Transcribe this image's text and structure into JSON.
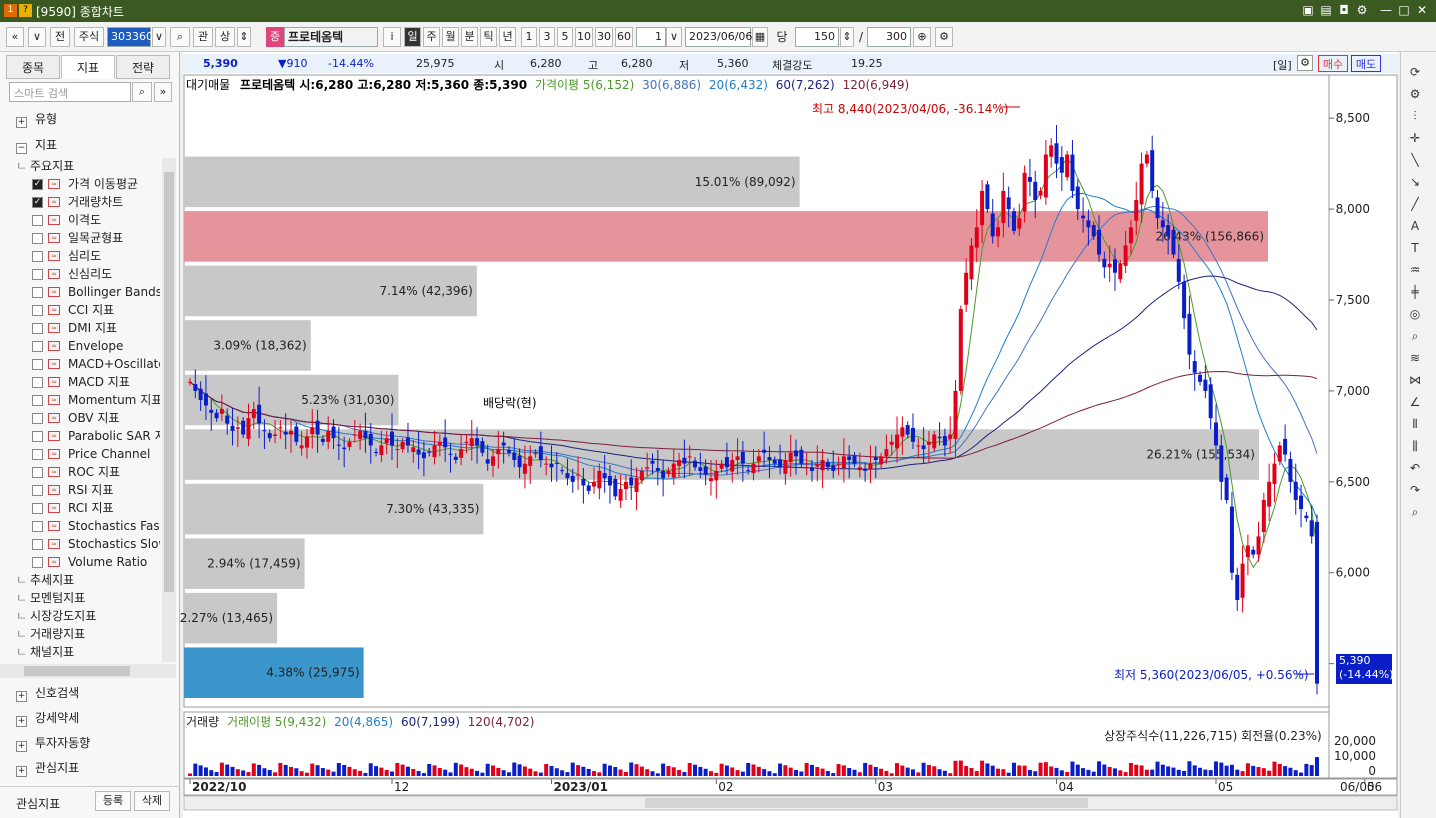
{
  "window": {
    "badge1": "1",
    "badge2": "?",
    "title": "[9590] 종합차트"
  },
  "toolbar": {
    "nav_prev": "«",
    "nav_down": "∨",
    "all": "전",
    "stock": "주식",
    "code": "303360",
    "kwan": "관",
    "sang": "상",
    "market_badge": "증",
    "name": "프로테옴텍",
    "info": "i",
    "periods": [
      "일",
      "주",
      "월",
      "분",
      "틱",
      "년"
    ],
    "intervals": [
      "1",
      "3",
      "5",
      "10",
      "30",
      "60"
    ],
    "unit_value": "1",
    "date": "2023/06/06",
    "dang": "당",
    "count": "150",
    "slash": "/",
    "total": "300"
  },
  "left": {
    "tabs": [
      "종목",
      "지표",
      "전략"
    ],
    "search_placeholder": "스마트 검색",
    "sections_top": [
      "유형",
      "지표"
    ],
    "group": "주요지표",
    "items": [
      {
        "label": "가격 이동평균",
        "checked": true
      },
      {
        "label": "거래량차트",
        "checked": true
      },
      {
        "label": "이격도",
        "checked": false
      },
      {
        "label": "일목균형표",
        "checked": false
      },
      {
        "label": "심리도",
        "checked": false
      },
      {
        "label": "신심리도",
        "checked": false
      },
      {
        "label": "Bollinger Bands",
        "checked": false
      },
      {
        "label": "CCI 지표",
        "checked": false
      },
      {
        "label": "DMI 지표",
        "checked": false
      },
      {
        "label": "Envelope",
        "checked": false
      },
      {
        "label": "MACD+Oscillato",
        "checked": false
      },
      {
        "label": "MACD 지표",
        "checked": false
      },
      {
        "label": "Momentum 지표",
        "checked": false
      },
      {
        "label": "OBV 지표",
        "checked": false
      },
      {
        "label": "Parabolic SAR 지",
        "checked": false
      },
      {
        "label": "Price Channel",
        "checked": false
      },
      {
        "label": "ROC 지표",
        "checked": false
      },
      {
        "label": "RSI 지표",
        "checked": false
      },
      {
        "label": "RCI 지표",
        "checked": false
      },
      {
        "label": "Stochastics Fast",
        "checked": false
      },
      {
        "label": "Stochastics Slow",
        "checked": false
      },
      {
        "label": "Volume Ratio",
        "checked": false
      }
    ],
    "groups_more": [
      "추세지표",
      "모멘텀지표",
      "시장강도지표",
      "거래량지표",
      "채널지표"
    ],
    "bottom_sections": [
      "신호검색",
      "강세약세",
      "투자자동향",
      "관심지표"
    ],
    "footer_label": "관심지표",
    "register": "등록",
    "delete": "삭제"
  },
  "strip": {
    "price": "5,390",
    "change": "▼910",
    "pct": "-14.44%",
    "volume": "25,975",
    "open_lbl": "시",
    "open": "6,280",
    "high_lbl": "고",
    "high": "6,280",
    "low_lbl": "저",
    "low": "5,360",
    "strength_lbl": "체결강도",
    "strength": "19.25",
    "period_btn": "[일]",
    "buy": "매수",
    "sell": "매도"
  },
  "legend": {
    "vp": "대기매물",
    "ohlc": "프로테옴텍 시:6,280 고:6,280 저:5,360 종:5,390",
    "ma5": "가격이평 5(6,152)",
    "ma20": "20(6,432)",
    "ma30": "30(6,886)",
    "ma60": "60(7,262)",
    "ma120": "120(6,949)"
  },
  "vol_legend": {
    "title": "거래량",
    "ma5": "거래이평 5(9,432)",
    "ma20": "20(4,865)",
    "ma60": "60(7,199)",
    "ma120": "120(4,702)",
    "listed": "상장주식수(11,226,715) 회전율(0.23%)"
  },
  "annotations": {
    "high": "최고 8,440(2023/04/06, -36.14%)",
    "low": "최저 5,360(2023/06/05, +0.56%)",
    "dividend": "배당락(현)",
    "last_price": "5,390",
    "last_pct": "(-14.44%)"
  },
  "colors": {
    "up": "#e0001a",
    "down": "#0a1ec8",
    "ma5": "#4c9a2a",
    "ma20": "#1e7fcf",
    "ma30": "#4472c4",
    "ma60": "#1a237e",
    "ma120": "#7b1f3a",
    "vp_gray": "#c8c8c8",
    "vp_red": "#e6949b",
    "vp_blue": "#3b96cc"
  },
  "chart_data": {
    "type": "candlestick",
    "ylim": [
      5300,
      8600
    ],
    "yticks": [
      5500,
      6000,
      6500,
      7000,
      7500,
      8000,
      8500
    ],
    "ytick_labels": [
      "5,500",
      "6,000",
      "6,500",
      "7,000",
      "7,500",
      "8,000",
      "8,500"
    ],
    "xticks": [
      {
        "label": "2022/10",
        "i": 0
      },
      {
        "label": "12",
        "i": 38
      },
      {
        "label": "2023/01",
        "i": 68
      },
      {
        "label": "02",
        "i": 99
      },
      {
        "label": "03",
        "i": 129
      },
      {
        "label": "04",
        "i": 163
      },
      {
        "label": "05",
        "i": 193
      },
      {
        "label": "06",
        "i": 221
      }
    ],
    "last_date": "06/05",
    "volume_ticks": [
      "20,000",
      "10,000",
      "0"
    ],
    "volume_profile": [
      {
        "low": 8000,
        "high": 8300,
        "pct": 15.01,
        "vol": 89092,
        "label": "15.01% (89,092)"
      },
      {
        "low": 7700,
        "high": 8000,
        "pct": 26.43,
        "vol": 156866,
        "label": "26.43% (156,866)"
      },
      {
        "low": 7400,
        "high": 7700,
        "pct": 7.14,
        "vol": 42396,
        "label": "7.14% (42,396)"
      },
      {
        "low": 7100,
        "high": 7400,
        "pct": 3.09,
        "vol": 18362,
        "label": "3.09% (18,362)"
      },
      {
        "low": 6800,
        "high": 7100,
        "pct": 5.23,
        "vol": 31030,
        "label": "5.23% (31,030)"
      },
      {
        "low": 6500,
        "high": 6800,
        "pct": 26.21,
        "vol": 155534,
        "label": "26.21% (155,534)"
      },
      {
        "low": 6200,
        "high": 6500,
        "pct": 7.3,
        "vol": 43335,
        "label": "7.30% (43,335)"
      },
      {
        "low": 5900,
        "high": 6200,
        "pct": 2.94,
        "vol": 17459,
        "label": "2.94% (17,459)"
      },
      {
        "low": 5600,
        "high": 5900,
        "pct": 2.27,
        "vol": 13465,
        "label": "2.27% (13,465)"
      },
      {
        "low": 5300,
        "high": 5600,
        "pct": 4.38,
        "vol": 25975,
        "label": "4.38% (25,975)"
      }
    ],
    "closes": [
      7050,
      7000,
      6950,
      6920,
      6880,
      6850,
      6900,
      6820,
      6780,
      6800,
      6760,
      6850,
      6900,
      6820,
      6780,
      6740,
      6760,
      6800,
      6760,
      6780,
      6720,
      6700,
      6750,
      6800,
      6760,
      6720,
      6780,
      6740,
      6700,
      6680,
      6720,
      6760,
      6780,
      6740,
      6700,
      6660,
      6700,
      6740,
      6700,
      6680,
      6720,
      6700,
      6690,
      6650,
      6630,
      6660,
      6700,
      6720,
      6690,
      6650,
      6620,
      6680,
      6720,
      6740,
      6700,
      6660,
      6600,
      6640,
      6680,
      6700,
      6660,
      6620,
      6580,
      6600,
      6640,
      6660,
      6620,
      6600,
      6580,
      6600,
      6560,
      6520,
      6500,
      6540,
      6480,
      6450,
      6500,
      6560,
      6520,
      6480,
      6420,
      6460,
      6500,
      6480,
      6520,
      6560,
      6580,
      6600,
      6560,
      6520,
      6560,
      6600,
      6620,
      6600,
      6640,
      6580,
      6560,
      6540,
      6520,
      6560,
      6600,
      6580,
      6620,
      6640,
      6600,
      6560,
      6600,
      6640,
      6660,
      6620,
      6600,
      6580,
      6620,
      6660,
      6640,
      6600,
      6580,
      6560,
      6600,
      6620,
      6580,
      6560,
      6600,
      6640,
      6620,
      6600,
      6580,
      6560,
      6600,
      6620,
      6640,
      6680,
      6720,
      6760,
      6800,
      6760,
      6720,
      6700,
      6680,
      6720,
      6760,
      6740,
      6700,
      6760,
      7000,
      7450,
      7650,
      7800,
      7900,
      8100,
      8000,
      7850,
      7900,
      8100,
      8000,
      7880,
      7950,
      8200,
      8150,
      8050,
      8100,
      8300,
      8350,
      8250,
      8200,
      8300,
      8100,
      8000,
      7950,
      7900,
      7850,
      7750,
      7680,
      7700,
      7650,
      7700,
      7800,
      7900,
      8050,
      8250,
      8300,
      8100,
      7950,
      7900,
      7850,
      7750,
      7600,
      7400,
      7200,
      7100,
      7050,
      7000,
      6850,
      6700,
      6500,
      6400,
      6000,
      5850,
      6050,
      6150,
      6100,
      6200,
      6400,
      6500,
      6600,
      6700,
      6650,
      6500,
      6400,
      6350,
      6300,
      6200,
      5390
    ],
    "ma_series": [
      "ma5",
      "ma20",
      "ma30",
      "ma60",
      "ma120"
    ]
  }
}
